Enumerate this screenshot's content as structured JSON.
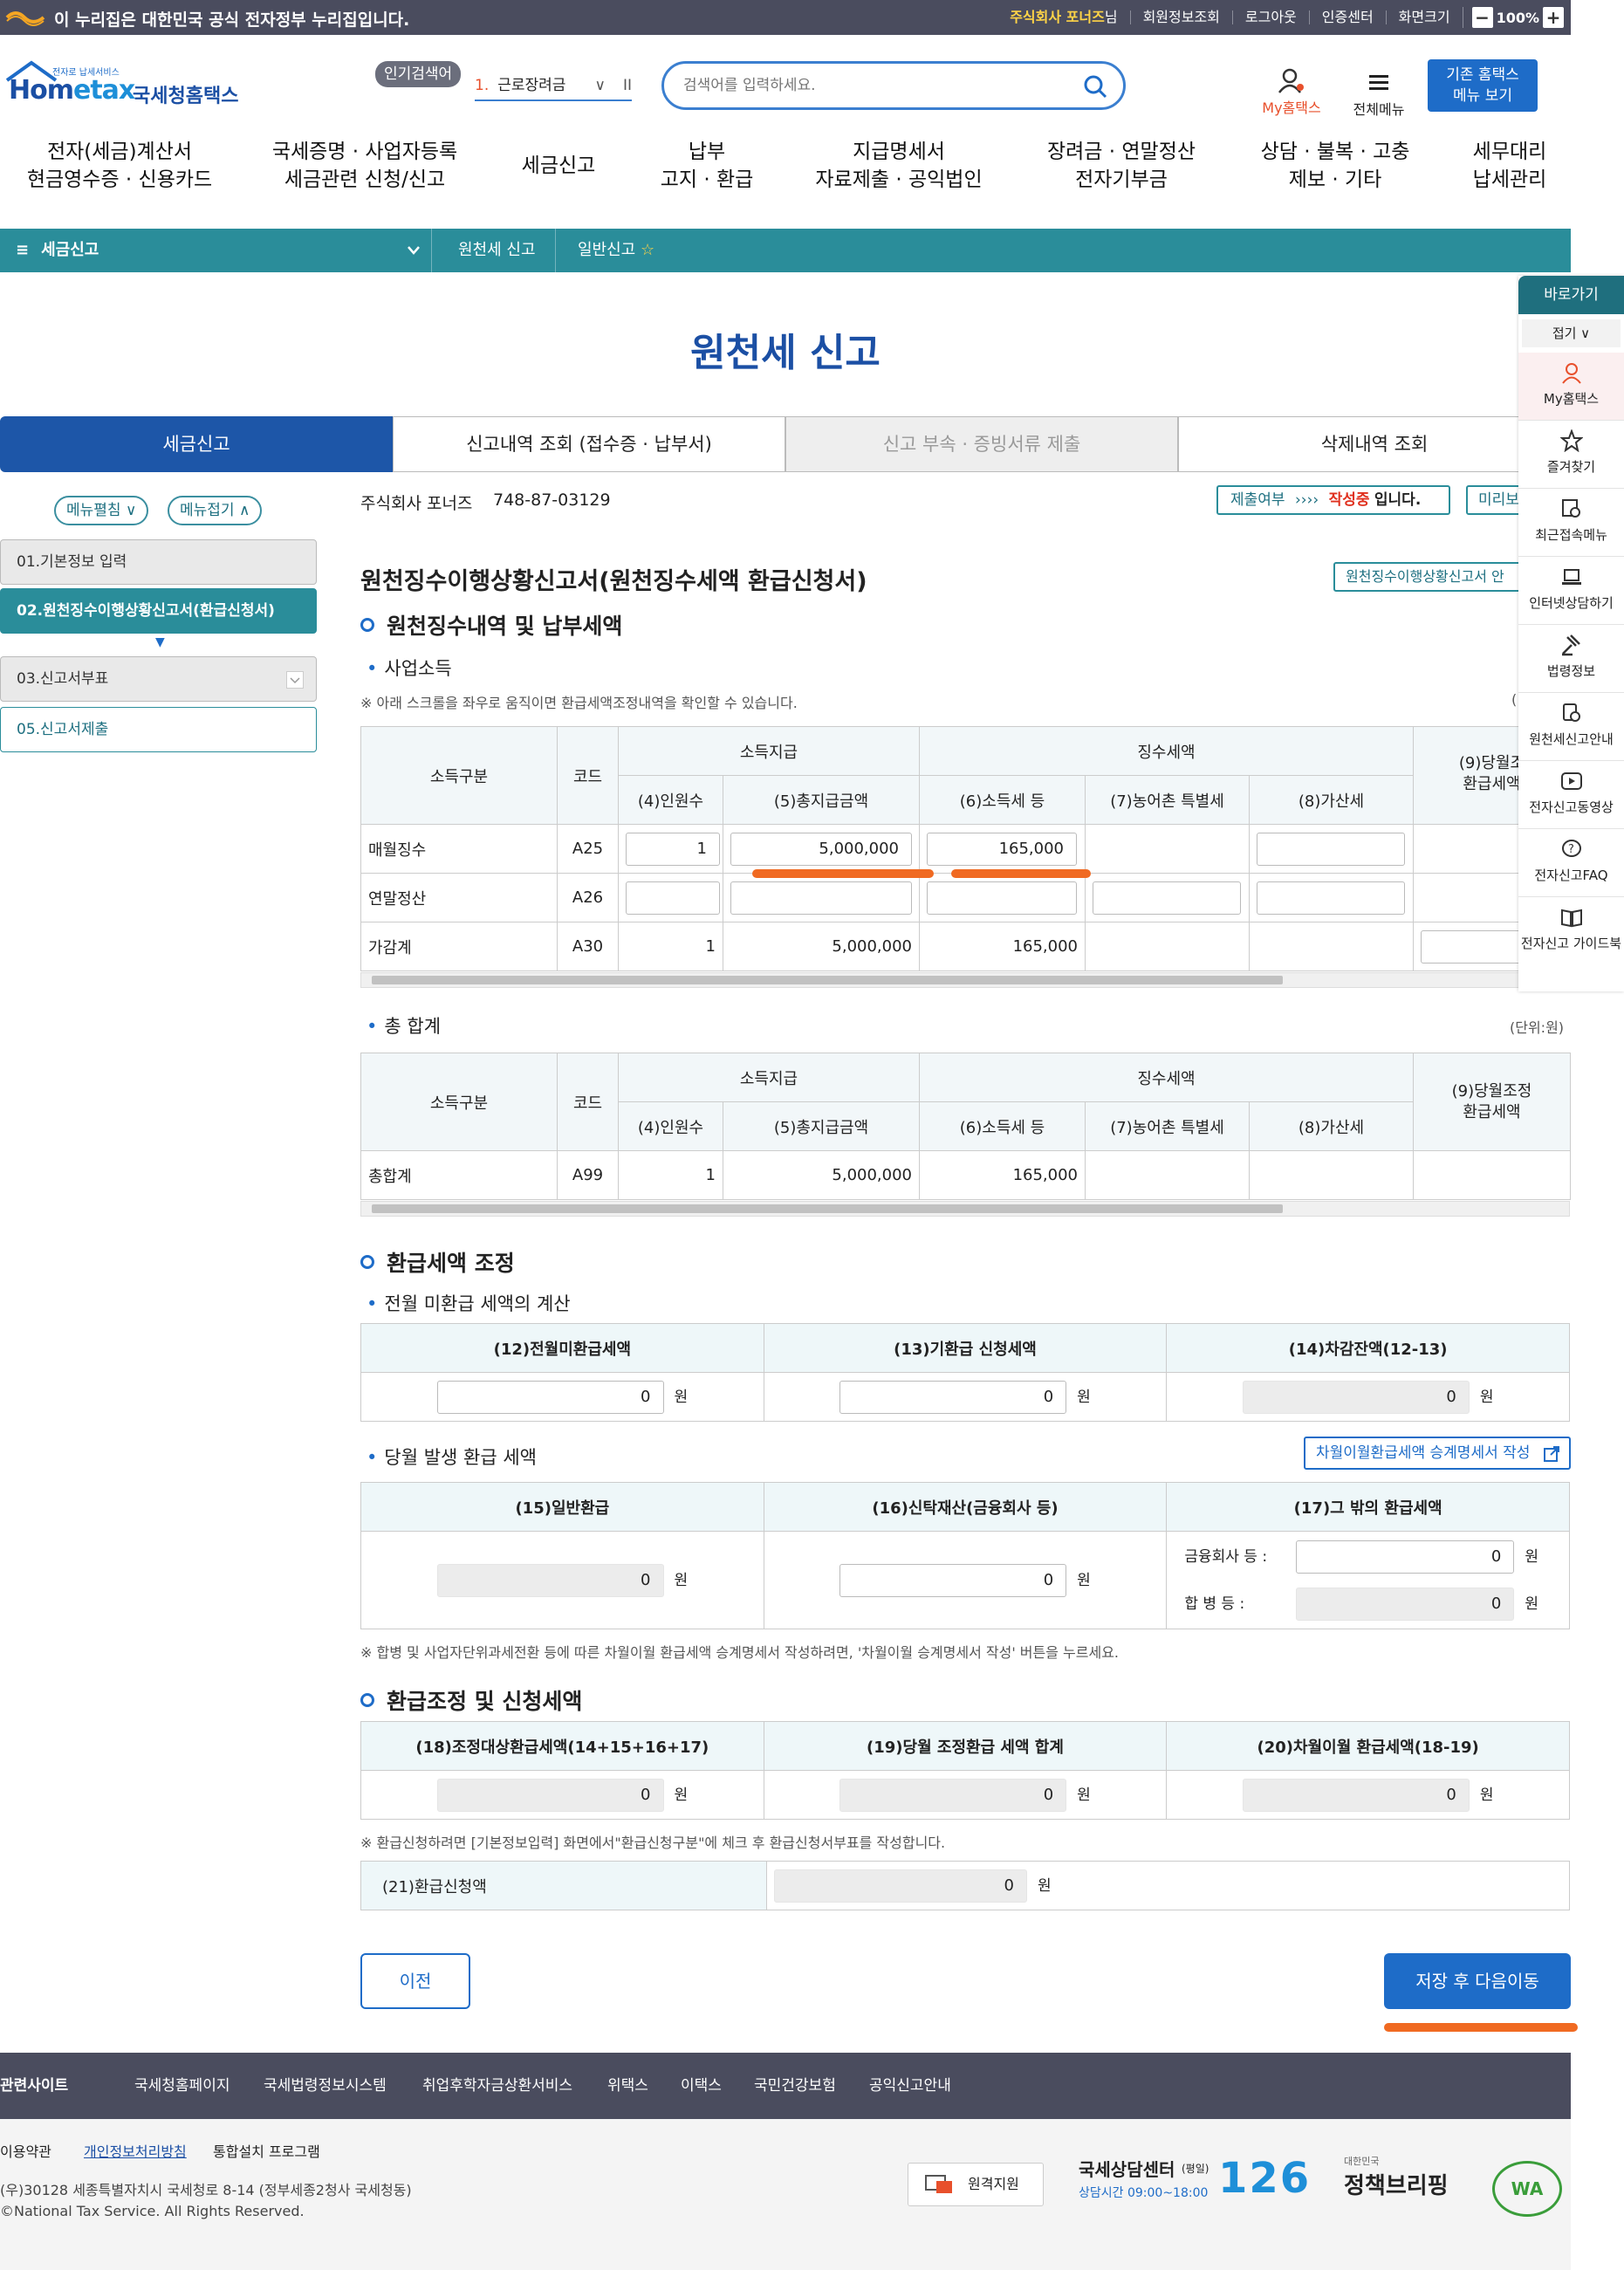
{
  "gov_banner": "이 누리집은 대한민국 공식 전자정부 누리집입니다.",
  "util": {
    "user": "주식회사 포너즈",
    "user_suffix": "님",
    "links": [
      "회원정보조회",
      "로그아웃",
      "인증센터",
      "화면크기"
    ],
    "zoom": "100%",
    "minus": "−",
    "plus": "+"
  },
  "logo": {
    "tagline": "전자로 납세서비스",
    "home": "Hom",
    "etax": "etax",
    "kr": "국세청홈택스"
  },
  "popular": {
    "label": "인기검색어",
    "num": "1.",
    "item": "근로장려금",
    "chev": "∨",
    "pause": "II"
  },
  "search": {
    "placeholder": "검색어를 입력하세요."
  },
  "header": {
    "my": "My홈택스",
    "all": "전체메뉴",
    "old_line1": "기존 홈택스",
    "old_line2": "메뉴 보기"
  },
  "gnb": [
    {
      "l1": "전자(세금)계산서",
      "l2": "현금영수증 · 신용카드"
    },
    {
      "l1": "국세증명 · 사업자등록",
      "l2": "세금관련 신청/신고"
    },
    {
      "l1": "세금신고",
      "l2": ""
    },
    {
      "l1": "납부",
      "l2": "고지 · 환급"
    },
    {
      "l1": "지급명세서",
      "l2": "자료제출 · 공익법인"
    },
    {
      "l1": "장려금 · 연말정산",
      "l2": "전자기부금"
    },
    {
      "l1": "상담 · 불복 · 고충",
      "l2": "제보 · 기타"
    },
    {
      "l1": "세무대리",
      "l2": "납세관리"
    }
  ],
  "crumb": {
    "menu": "≡",
    "c1": "세금신고",
    "c2": "원천세 신고",
    "c3": "일반신고",
    "star": "☆"
  },
  "title": "원천세 신고",
  "tabs": [
    "세금신고",
    "신고내역 조회 (접수증 · 납부서)",
    "신고 부속 · 증빙서류 제출",
    "삭제내역 조회"
  ],
  "leftnav": {
    "edit": "메뉴펼침 ∨",
    "fold": "메뉴접기 ∧",
    "items": [
      "01.기본정보 입력",
      "02.원천징수이행상황신고서(환급신청서)",
      "03.신고서부표",
      "05.신고서제출"
    ],
    "arrow": "▼"
  },
  "company": {
    "name": "주식회사 포너즈",
    "bizno": "748-87-03129",
    "status_label": "제출여부",
    "status_arrows": "››››",
    "status_value": "작성중",
    "status_tail": "입니다.",
    "preview": "미리보"
  },
  "form": {
    "title": "원천징수이행상황신고서(원천징수세액 환급신청서)",
    "link": "원천징수이행상황신고서 안",
    "sec1": "원천징수내역 및 납부세액",
    "sub1": "사업소득",
    "note1": "※ 아래 스크롤을 좌우로 움직이면 환급세액조정내역을 확인할 수 있습니다.",
    "note1_right": "(",
    "headers": {
      "kind": "소득구분",
      "code": "코드",
      "pay": "소득지급",
      "tax": "징수세액",
      "c4": "(4)인원수",
      "c5": "(5)총지급금액",
      "c6": "(6)소득세 등",
      "c7": "(7)농어촌 특별세",
      "c8": "(8)가산세",
      "c9a": "(9)당월조",
      "c9b": "환급세액",
      "c9full_a": "(9)당월조정",
      "c9full_b": "환급세액"
    },
    "rows": [
      {
        "kind": "매월징수",
        "code": "A25",
        "n": "1",
        "pay": "5,000,000",
        "tax": "165,000"
      },
      {
        "kind": "연말정산",
        "code": "A26",
        "n": "",
        "pay": "",
        "tax": ""
      },
      {
        "kind": "가감계",
        "code": "A30",
        "n": "1",
        "pay": "5,000,000",
        "tax": "165,000"
      }
    ],
    "sub2": "총 합계",
    "unit": "(단위:원)",
    "total": {
      "kind": "총합계",
      "code": "A99",
      "n": "1",
      "pay": "5,000,000",
      "tax": "165,000"
    },
    "sec2": "환급세액 조정",
    "sub3": "전월 미환급 세액의 계산",
    "h12": "(12)전월미환급세액",
    "h13": "(13)기환급 신청세액",
    "h14": "(14)차감잔액(12-13)",
    "v12": "0",
    "v13": "0",
    "v14": "0",
    "won": "원",
    "sub4": "당월 발생 환급 세액",
    "carry_btn": "차월이월환급세액 승계명세서 작성",
    "h15": "(15)일반환급",
    "h16": "(16)신탁재산(금융회사 등)",
    "h17": "(17)그 밖의 환급세액",
    "v15": "0",
    "v16": "0",
    "fin_label": "금융회사 등 :",
    "fin_v": "0",
    "merge_label": "합  병  등 :",
    "merge_v": "0",
    "note2": "※ 합병 및 사업자단위과세전환 등에 따른 차월이월 환급세액 승계명세서 작성하려면, '차월이월 승계명세서 작성' 버튼을 누르세요.",
    "sec3": "환급조정 및 신청세액",
    "h18": "(18)조정대상환급세액(14+15+16+17)",
    "h19": "(19)당월 조정환급 세액 합계",
    "h20": "(20)차월이월 환급세액(18-19)",
    "v18": "0",
    "v19": "0",
    "v20": "0",
    "note3": "※ 환급신청하려면 [기본정보입력] 화면에서\"환급신청구분\"에 체크 후 환급신청서부표를 작성합니다.",
    "h21": "(21)환급신청액",
    "v21": "0"
  },
  "buttons": {
    "prev": "이전",
    "next": "저장 후 다음이동"
  },
  "quick": {
    "title": "바로가기",
    "fold": "접기 ∨",
    "items": [
      "My홈택스",
      "즐겨찾기",
      "최근접속메뉴",
      "인터넷상담하기",
      "법령정보",
      "원천세신고안내",
      "전자신고동영상",
      "전자신고FAQ",
      "전자신고 가이드북"
    ]
  },
  "footer": {
    "links": [
      "관련사이트",
      "국세청홈페이지",
      "국세법령정보시스템",
      "취업후학자금상환서비스",
      "위택스",
      "이택스",
      "국민건강보험",
      "공익신고안내"
    ],
    "policy": [
      "이용약관",
      "개인정보처리방침",
      "통합설치 프로그램"
    ],
    "addr": "(우)30128 세종특별자치시 국세청로 8-14 (정부세종2청사 국세청동)",
    "copy": "©National Tax Service. All Rights Reserved.",
    "remote": "원격지원",
    "center": "국세상담센터",
    "center_days": "(평일)",
    "hours": "상담시간 09:00~18:00",
    "num": "126",
    "brief_small": "대한민국",
    "brief": "정책브리핑",
    "wa": "WA"
  }
}
